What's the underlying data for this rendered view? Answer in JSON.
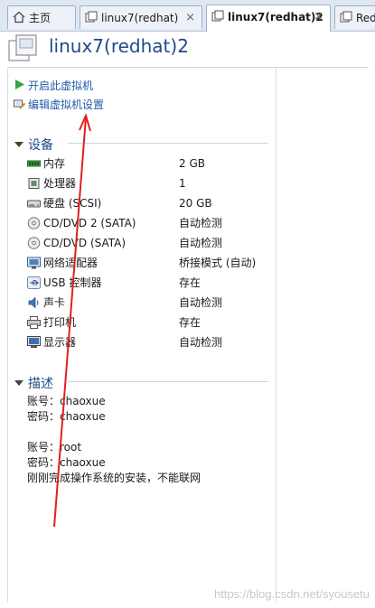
{
  "tabs": [
    {
      "label": "主页",
      "icon": "home-icon"
    },
    {
      "label": "linux7(redhat)",
      "icon": "vm-tab-icon",
      "close": "×"
    },
    {
      "label": "linux7(redhat)2",
      "icon": "vm-tab-icon",
      "close": "×",
      "active": true
    },
    {
      "label": "Red",
      "icon": "vm-tab-icon"
    }
  ],
  "vm": {
    "title": "linux7(redhat)2",
    "icon": "virtual-machine-icon"
  },
  "actions": [
    {
      "label": "开启此虚拟机",
      "icon": "play-icon"
    },
    {
      "label": "编辑虚拟机设置",
      "icon": "edit-settings-icon"
    }
  ],
  "devices_section": {
    "title": "设备",
    "items": [
      {
        "name": "内存",
        "value": "2 GB",
        "icon": "memory-icon"
      },
      {
        "name": "处理器",
        "value": "1",
        "icon": "processor-icon"
      },
      {
        "name": "硬盘 (SCSI)",
        "value": "20 GB",
        "icon": "hard-disk-icon"
      },
      {
        "name": "CD/DVD 2 (SATA)",
        "value": "自动检测",
        "icon": "cd-dvd-icon"
      },
      {
        "name": "CD/DVD (SATA)",
        "value": "自动检测",
        "icon": "cd-dvd-icon"
      },
      {
        "name": "网络适配器",
        "value": "桥接模式 (自动)",
        "icon": "network-adapter-icon"
      },
      {
        "name": "USB 控制器",
        "value": "存在",
        "icon": "usb-icon"
      },
      {
        "name": "声卡",
        "value": "自动检测",
        "icon": "sound-card-icon"
      },
      {
        "name": "打印机",
        "value": "存在",
        "icon": "printer-icon"
      },
      {
        "name": "显示器",
        "value": "自动检测",
        "icon": "display-icon"
      }
    ]
  },
  "description_section": {
    "title": "描述",
    "lines": [
      "账号：chaoxue",
      "密码：chaoxue",
      "",
      "账号：root",
      "密码：chaoxue",
      "刚刚完成操作系统的安装，不能联网"
    ]
  },
  "watermark": "https://blog.csdn.net/syousetu",
  "colors": {
    "accent": "#1e4a8a",
    "link": "#1f5ba8",
    "arrow": "#e02020"
  }
}
